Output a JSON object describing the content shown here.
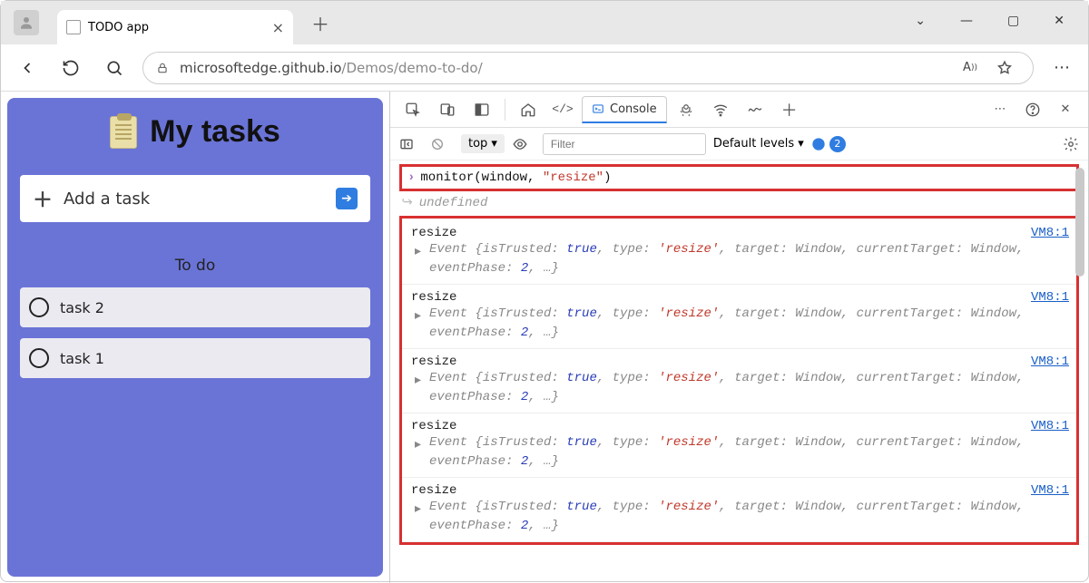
{
  "window": {
    "tab_title": "TODO app",
    "new_tab_tooltip": "New tab",
    "controls": {
      "min": "—",
      "max": "▢",
      "close": "✕"
    }
  },
  "url": {
    "host": "microsoftedge.github.io",
    "path": "/Demos/demo-to-do/"
  },
  "page": {
    "title": "My tasks",
    "add_placeholder": "Add a task",
    "section": "To do",
    "tasks": [
      "task 2",
      "task 1"
    ]
  },
  "devtools": {
    "tab_label": "Console",
    "context_label": "top",
    "filter_placeholder": "Filter",
    "levels_label": "Default levels",
    "issue_count": "2",
    "input": {
      "fn": "monitor",
      "args_prefix": "(window, ",
      "args_str": "\"resize\"",
      "args_suffix": ")"
    },
    "undefined_label": "undefined",
    "log": {
      "event_name": "resize",
      "source": "VM8:1",
      "detail": {
        "prefix": "Event {",
        "k1": "isTrusted",
        "v1": "true",
        "k2": "type",
        "v2": "'resize'",
        "k3": "target",
        "v3": "Window",
        "k4": "currentTarget",
        "v4": "Window",
        "k5": "eventPhase",
        "v5": "2",
        "suffix": ", …}"
      },
      "repeat": 5
    }
  }
}
